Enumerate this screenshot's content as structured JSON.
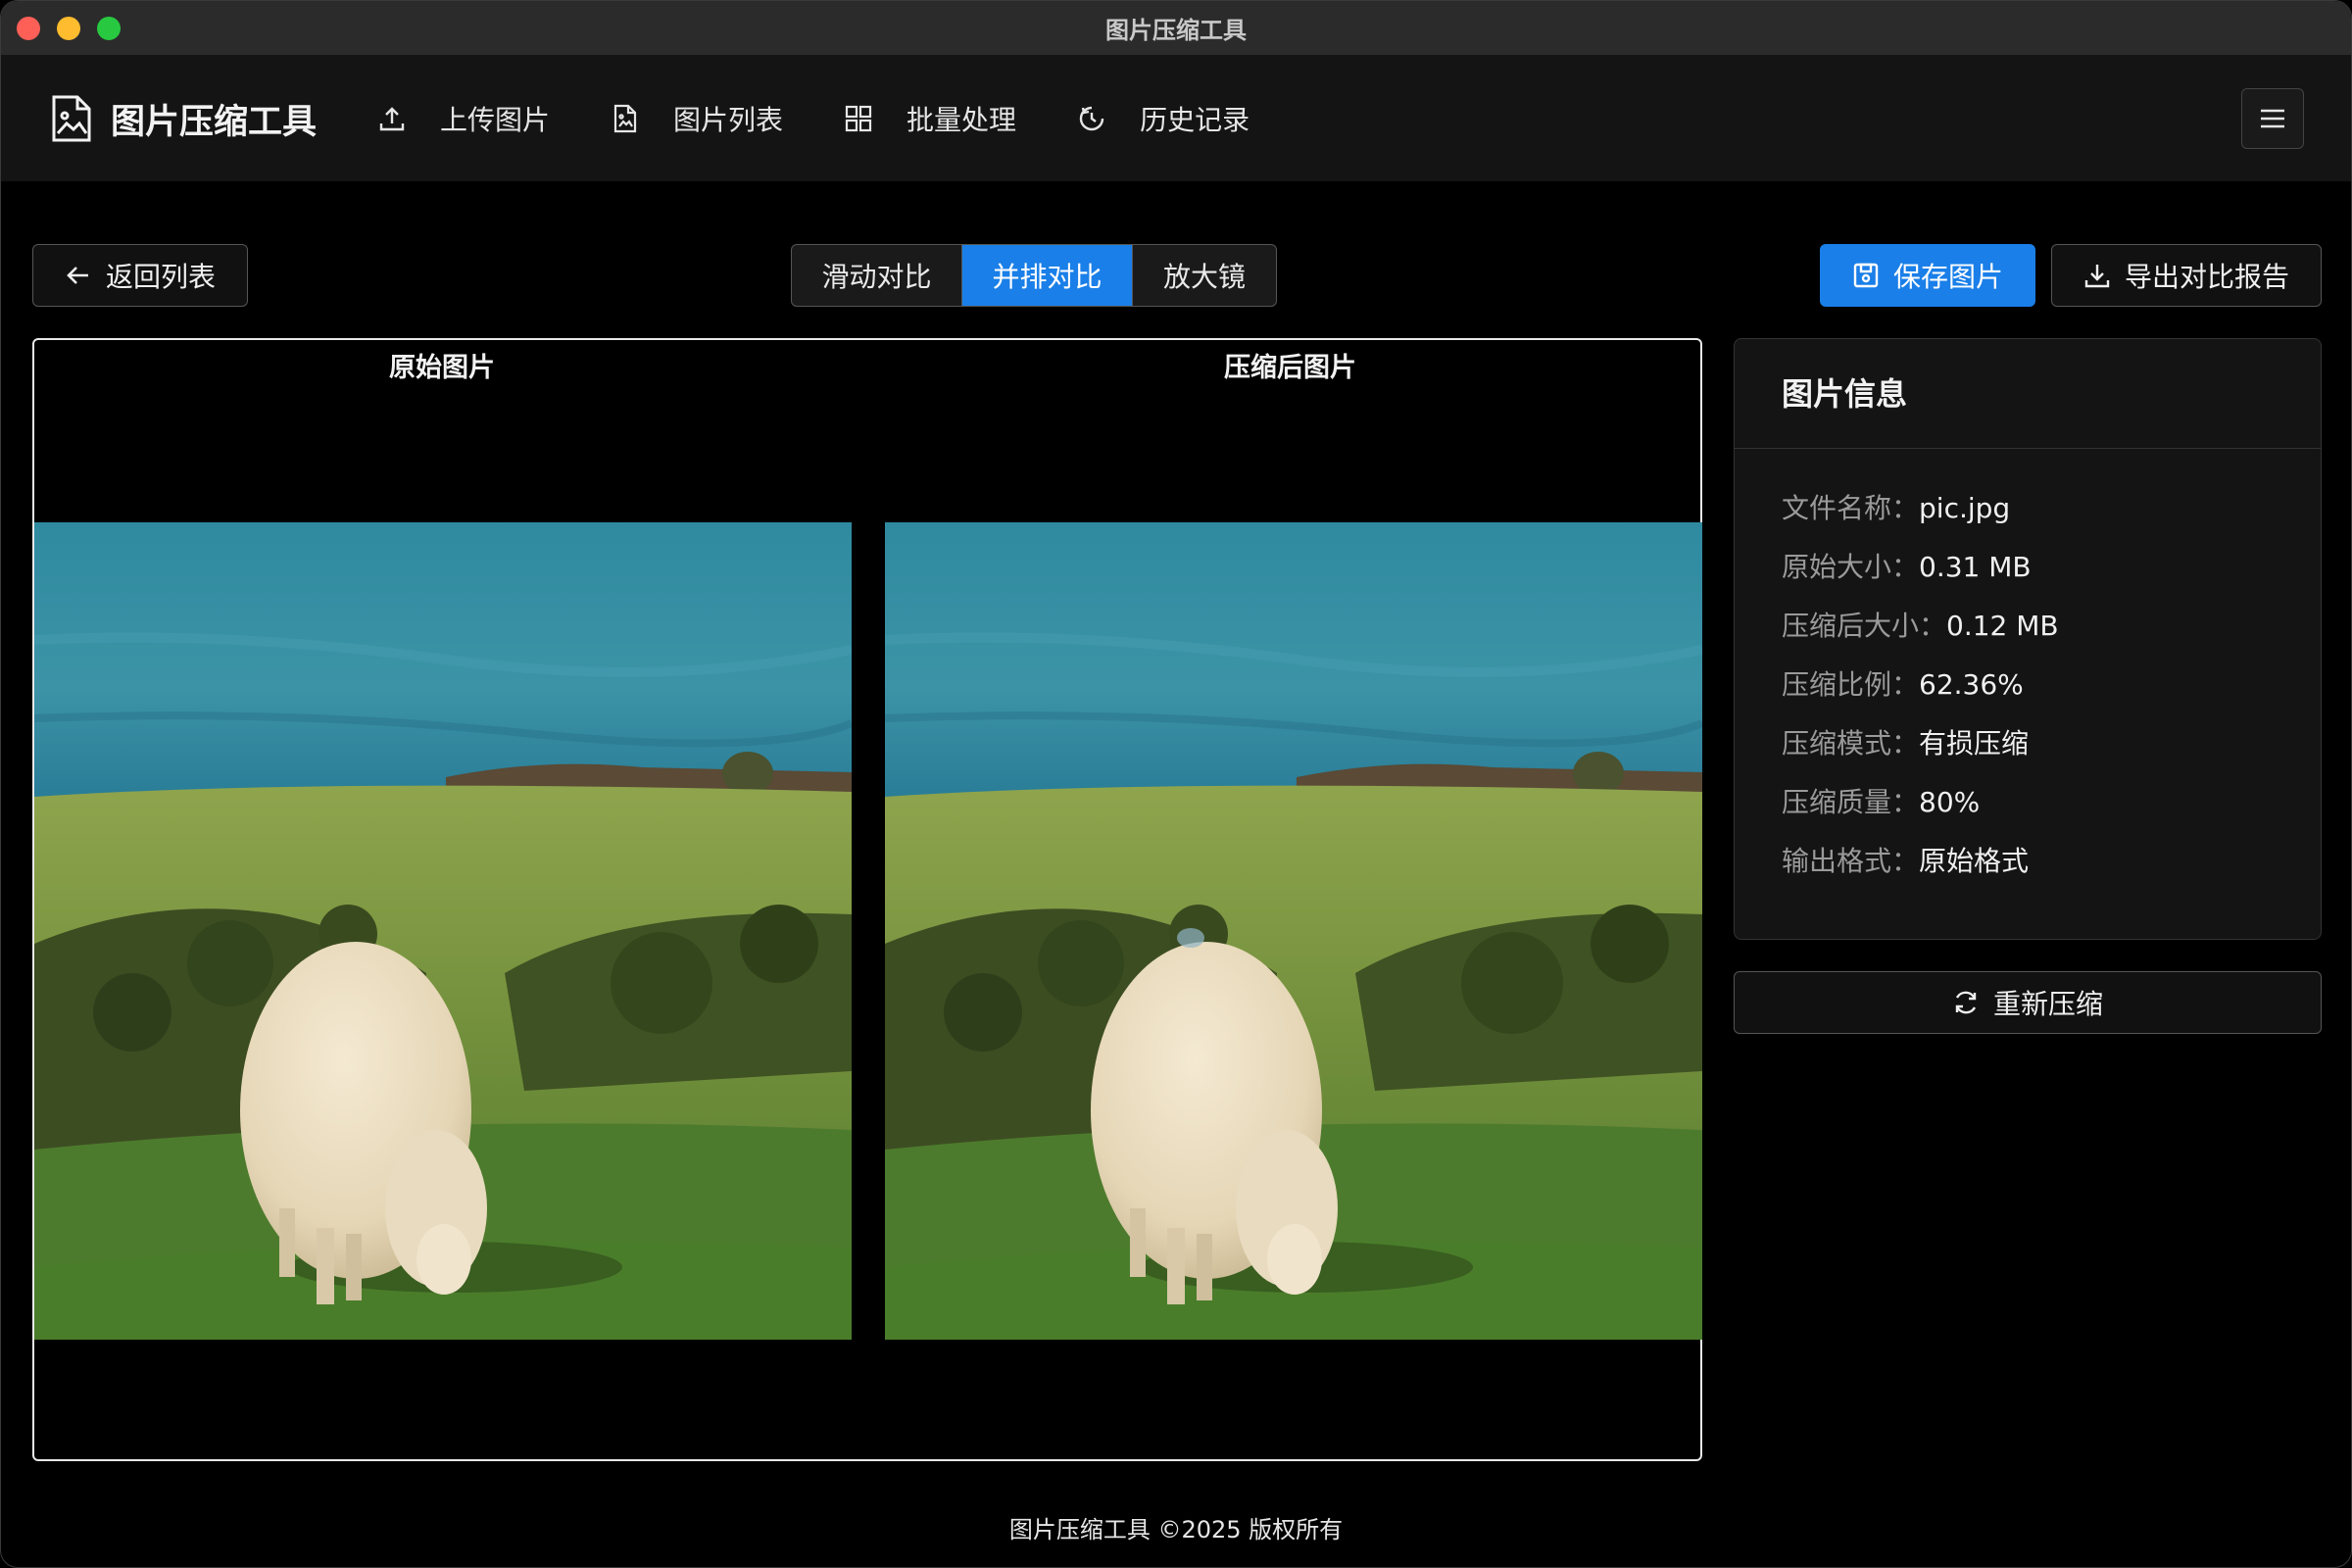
{
  "window": {
    "title": "图片压缩工具"
  },
  "header": {
    "brand": "图片压缩工具",
    "nav": [
      {
        "label": "上传图片",
        "icon": "upload-icon"
      },
      {
        "label": "图片列表",
        "icon": "image-file-icon"
      },
      {
        "label": "批量处理",
        "icon": "grid-icon"
      },
      {
        "label": "历史记录",
        "icon": "history-icon"
      }
    ],
    "menu_icon": "hamburger-icon"
  },
  "toolbar": {
    "back_label": "返回列表",
    "modes": [
      {
        "label": "滑动对比",
        "active": false
      },
      {
        "label": "并排对比",
        "active": true
      },
      {
        "label": "放大镜",
        "active": false
      }
    ],
    "save_label": "保存图片",
    "export_label": "导出对比报告"
  },
  "compare": {
    "original_title": "原始图片",
    "compressed_title": "压缩后图片"
  },
  "info": {
    "title": "图片信息",
    "rows": [
      {
        "key": "文件名称：",
        "value": "pic.jpg"
      },
      {
        "key": "原始大小：",
        "value": "0.31 MB"
      },
      {
        "key": "压缩后大小：",
        "value": "0.12 MB"
      },
      {
        "key": "压缩比例：",
        "value": "62.36%"
      },
      {
        "key": "压缩模式：",
        "value": "有损压缩"
      },
      {
        "key": "压缩质量：",
        "value": "80%"
      },
      {
        "key": "输出格式：",
        "value": "原始格式"
      }
    ],
    "recompress_label": "重新压缩"
  },
  "footer": {
    "text": "图片压缩工具 ©2025 版权所有"
  },
  "colors": {
    "accent": "#1a7fe8",
    "background": "#000000",
    "panel": "#141414"
  }
}
